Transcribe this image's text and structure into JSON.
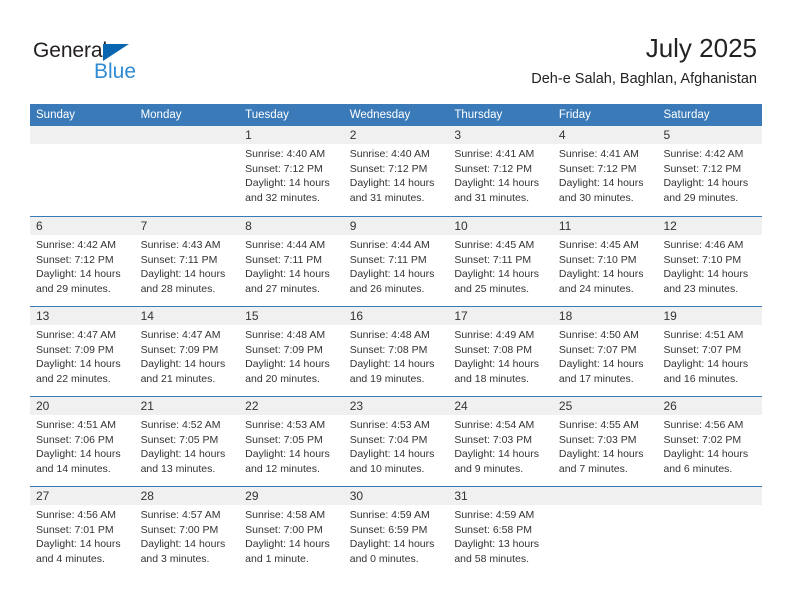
{
  "brand": {
    "name_part1": "General",
    "name_part2": "Blue",
    "triangle_color": "#0a66b0",
    "blue_color": "#2e8bd4"
  },
  "header": {
    "title": "July 2025",
    "subtitle": "Deh-e Salah, Baghlan, Afghanistan"
  },
  "theme": {
    "header_blue": "#3a7ab8",
    "daynum_band": "#f0f0f0",
    "text": "#333333"
  },
  "weekdays": [
    "Sunday",
    "Monday",
    "Tuesday",
    "Wednesday",
    "Thursday",
    "Friday",
    "Saturday"
  ],
  "weeks": [
    [
      {
        "day": "",
        "empty": true,
        "sunrise": "",
        "sunset": "",
        "daylight1": "",
        "daylight2": ""
      },
      {
        "day": "",
        "empty": true,
        "sunrise": "",
        "sunset": "",
        "daylight1": "",
        "daylight2": ""
      },
      {
        "day": "1",
        "sunrise": "Sunrise: 4:40 AM",
        "sunset": "Sunset: 7:12 PM",
        "daylight1": "Daylight: 14 hours",
        "daylight2": "and 32 minutes."
      },
      {
        "day": "2",
        "sunrise": "Sunrise: 4:40 AM",
        "sunset": "Sunset: 7:12 PM",
        "daylight1": "Daylight: 14 hours",
        "daylight2": "and 31 minutes."
      },
      {
        "day": "3",
        "sunrise": "Sunrise: 4:41 AM",
        "sunset": "Sunset: 7:12 PM",
        "daylight1": "Daylight: 14 hours",
        "daylight2": "and 31 minutes."
      },
      {
        "day": "4",
        "sunrise": "Sunrise: 4:41 AM",
        "sunset": "Sunset: 7:12 PM",
        "daylight1": "Daylight: 14 hours",
        "daylight2": "and 30 minutes."
      },
      {
        "day": "5",
        "sunrise": "Sunrise: 4:42 AM",
        "sunset": "Sunset: 7:12 PM",
        "daylight1": "Daylight: 14 hours",
        "daylight2": "and 29 minutes."
      }
    ],
    [
      {
        "day": "6",
        "sunrise": "Sunrise: 4:42 AM",
        "sunset": "Sunset: 7:12 PM",
        "daylight1": "Daylight: 14 hours",
        "daylight2": "and 29 minutes."
      },
      {
        "day": "7",
        "sunrise": "Sunrise: 4:43 AM",
        "sunset": "Sunset: 7:11 PM",
        "daylight1": "Daylight: 14 hours",
        "daylight2": "and 28 minutes."
      },
      {
        "day": "8",
        "sunrise": "Sunrise: 4:44 AM",
        "sunset": "Sunset: 7:11 PM",
        "daylight1": "Daylight: 14 hours",
        "daylight2": "and 27 minutes."
      },
      {
        "day": "9",
        "sunrise": "Sunrise: 4:44 AM",
        "sunset": "Sunset: 7:11 PM",
        "daylight1": "Daylight: 14 hours",
        "daylight2": "and 26 minutes."
      },
      {
        "day": "10",
        "sunrise": "Sunrise: 4:45 AM",
        "sunset": "Sunset: 7:11 PM",
        "daylight1": "Daylight: 14 hours",
        "daylight2": "and 25 minutes."
      },
      {
        "day": "11",
        "sunrise": "Sunrise: 4:45 AM",
        "sunset": "Sunset: 7:10 PM",
        "daylight1": "Daylight: 14 hours",
        "daylight2": "and 24 minutes."
      },
      {
        "day": "12",
        "sunrise": "Sunrise: 4:46 AM",
        "sunset": "Sunset: 7:10 PM",
        "daylight1": "Daylight: 14 hours",
        "daylight2": "and 23 minutes."
      }
    ],
    [
      {
        "day": "13",
        "sunrise": "Sunrise: 4:47 AM",
        "sunset": "Sunset: 7:09 PM",
        "daylight1": "Daylight: 14 hours",
        "daylight2": "and 22 minutes."
      },
      {
        "day": "14",
        "sunrise": "Sunrise: 4:47 AM",
        "sunset": "Sunset: 7:09 PM",
        "daylight1": "Daylight: 14 hours",
        "daylight2": "and 21 minutes."
      },
      {
        "day": "15",
        "sunrise": "Sunrise: 4:48 AM",
        "sunset": "Sunset: 7:09 PM",
        "daylight1": "Daylight: 14 hours",
        "daylight2": "and 20 minutes."
      },
      {
        "day": "16",
        "sunrise": "Sunrise: 4:48 AM",
        "sunset": "Sunset: 7:08 PM",
        "daylight1": "Daylight: 14 hours",
        "daylight2": "and 19 minutes."
      },
      {
        "day": "17",
        "sunrise": "Sunrise: 4:49 AM",
        "sunset": "Sunset: 7:08 PM",
        "daylight1": "Daylight: 14 hours",
        "daylight2": "and 18 minutes."
      },
      {
        "day": "18",
        "sunrise": "Sunrise: 4:50 AM",
        "sunset": "Sunset: 7:07 PM",
        "daylight1": "Daylight: 14 hours",
        "daylight2": "and 17 minutes."
      },
      {
        "day": "19",
        "sunrise": "Sunrise: 4:51 AM",
        "sunset": "Sunset: 7:07 PM",
        "daylight1": "Daylight: 14 hours",
        "daylight2": "and 16 minutes."
      }
    ],
    [
      {
        "day": "20",
        "sunrise": "Sunrise: 4:51 AM",
        "sunset": "Sunset: 7:06 PM",
        "daylight1": "Daylight: 14 hours",
        "daylight2": "and 14 minutes."
      },
      {
        "day": "21",
        "sunrise": "Sunrise: 4:52 AM",
        "sunset": "Sunset: 7:05 PM",
        "daylight1": "Daylight: 14 hours",
        "daylight2": "and 13 minutes."
      },
      {
        "day": "22",
        "sunrise": "Sunrise: 4:53 AM",
        "sunset": "Sunset: 7:05 PM",
        "daylight1": "Daylight: 14 hours",
        "daylight2": "and 12 minutes."
      },
      {
        "day": "23",
        "sunrise": "Sunrise: 4:53 AM",
        "sunset": "Sunset: 7:04 PM",
        "daylight1": "Daylight: 14 hours",
        "daylight2": "and 10 minutes."
      },
      {
        "day": "24",
        "sunrise": "Sunrise: 4:54 AM",
        "sunset": "Sunset: 7:03 PM",
        "daylight1": "Daylight: 14 hours",
        "daylight2": "and 9 minutes."
      },
      {
        "day": "25",
        "sunrise": "Sunrise: 4:55 AM",
        "sunset": "Sunset: 7:03 PM",
        "daylight1": "Daylight: 14 hours",
        "daylight2": "and 7 minutes."
      },
      {
        "day": "26",
        "sunrise": "Sunrise: 4:56 AM",
        "sunset": "Sunset: 7:02 PM",
        "daylight1": "Daylight: 14 hours",
        "daylight2": "and 6 minutes."
      }
    ],
    [
      {
        "day": "27",
        "sunrise": "Sunrise: 4:56 AM",
        "sunset": "Sunset: 7:01 PM",
        "daylight1": "Daylight: 14 hours",
        "daylight2": "and 4 minutes."
      },
      {
        "day": "28",
        "sunrise": "Sunrise: 4:57 AM",
        "sunset": "Sunset: 7:00 PM",
        "daylight1": "Daylight: 14 hours",
        "daylight2": "and 3 minutes."
      },
      {
        "day": "29",
        "sunrise": "Sunrise: 4:58 AM",
        "sunset": "Sunset: 7:00 PM",
        "daylight1": "Daylight: 14 hours",
        "daylight2": "and 1 minute."
      },
      {
        "day": "30",
        "sunrise": "Sunrise: 4:59 AM",
        "sunset": "Sunset: 6:59 PM",
        "daylight1": "Daylight: 14 hours",
        "daylight2": "and 0 minutes."
      },
      {
        "day": "31",
        "sunrise": "Sunrise: 4:59 AM",
        "sunset": "Sunset: 6:58 PM",
        "daylight1": "Daylight: 13 hours",
        "daylight2": "and 58 minutes."
      },
      {
        "day": "",
        "empty": true,
        "sunrise": "",
        "sunset": "",
        "daylight1": "",
        "daylight2": ""
      },
      {
        "day": "",
        "empty": true,
        "sunrise": "",
        "sunset": "",
        "daylight1": "",
        "daylight2": ""
      }
    ]
  ]
}
